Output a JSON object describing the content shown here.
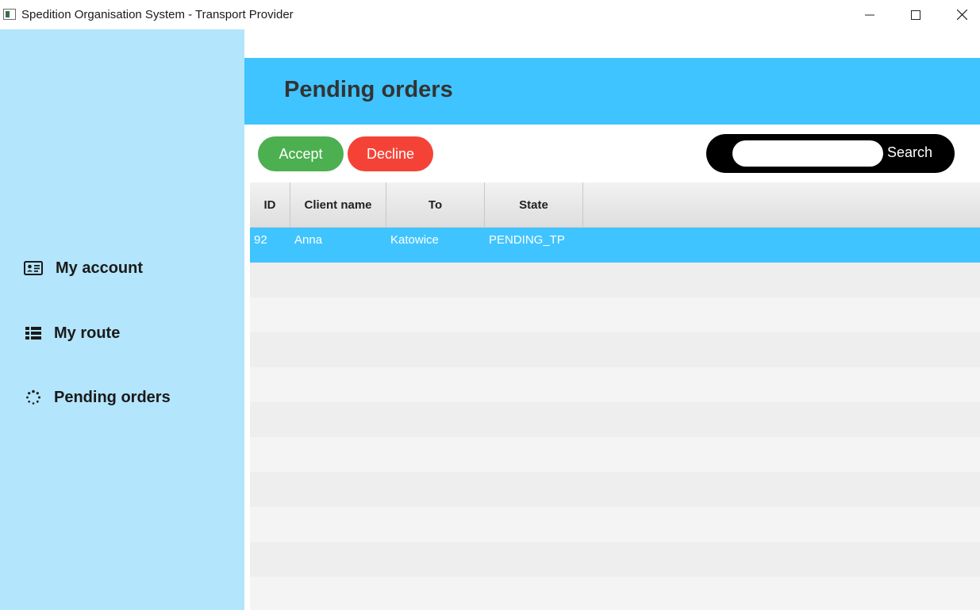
{
  "window": {
    "title": "Spedition Organisation System - Transport Provider"
  },
  "sidebar": {
    "items": [
      {
        "label": "My account",
        "icon": "id-card-icon"
      },
      {
        "label": "My route",
        "icon": "list-icon"
      },
      {
        "label": "Pending orders",
        "icon": "spinner-icon"
      }
    ]
  },
  "header": {
    "title": "Pending orders"
  },
  "toolbar": {
    "accept_label": "Accept",
    "decline_label": "Decline",
    "search_label": "Search",
    "search_value": ""
  },
  "table": {
    "columns": [
      "ID",
      "Client name",
      "To",
      "State"
    ],
    "rows": [
      {
        "id": "92",
        "client_name": "Anna",
        "to": "Katowice",
        "state": "PENDING_TP",
        "selected": true
      }
    ]
  },
  "colors": {
    "sidebar": "#b3e5fc",
    "header": "#40c4ff",
    "accept": "#4caf50",
    "decline": "#f44336",
    "selected_row": "#40c4ff"
  }
}
